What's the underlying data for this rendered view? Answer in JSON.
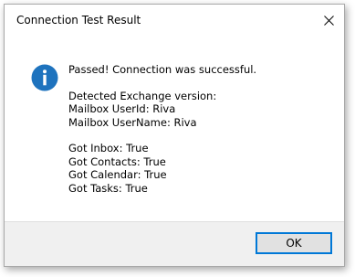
{
  "window": {
    "title": "Connection Test Result",
    "close_icon": "close-icon"
  },
  "message": {
    "icon": "info-icon",
    "status": "Passed! Connection was successful.",
    "version_label": "Detected Exchange version:",
    "user_id": "Mailbox UserId: Riva",
    "user_name": "Mailbox UserName: Riva",
    "inbox": "Got Inbox: True",
    "contacts": "Got Contacts: True",
    "calendar": "Got Calendar: True",
    "tasks": "Got Tasks: True"
  },
  "buttons": {
    "ok_label": "OK"
  },
  "colors": {
    "accent": "#0078d7",
    "info_icon_fill": "#1e73be",
    "footer_background": "#f0f0f0"
  }
}
